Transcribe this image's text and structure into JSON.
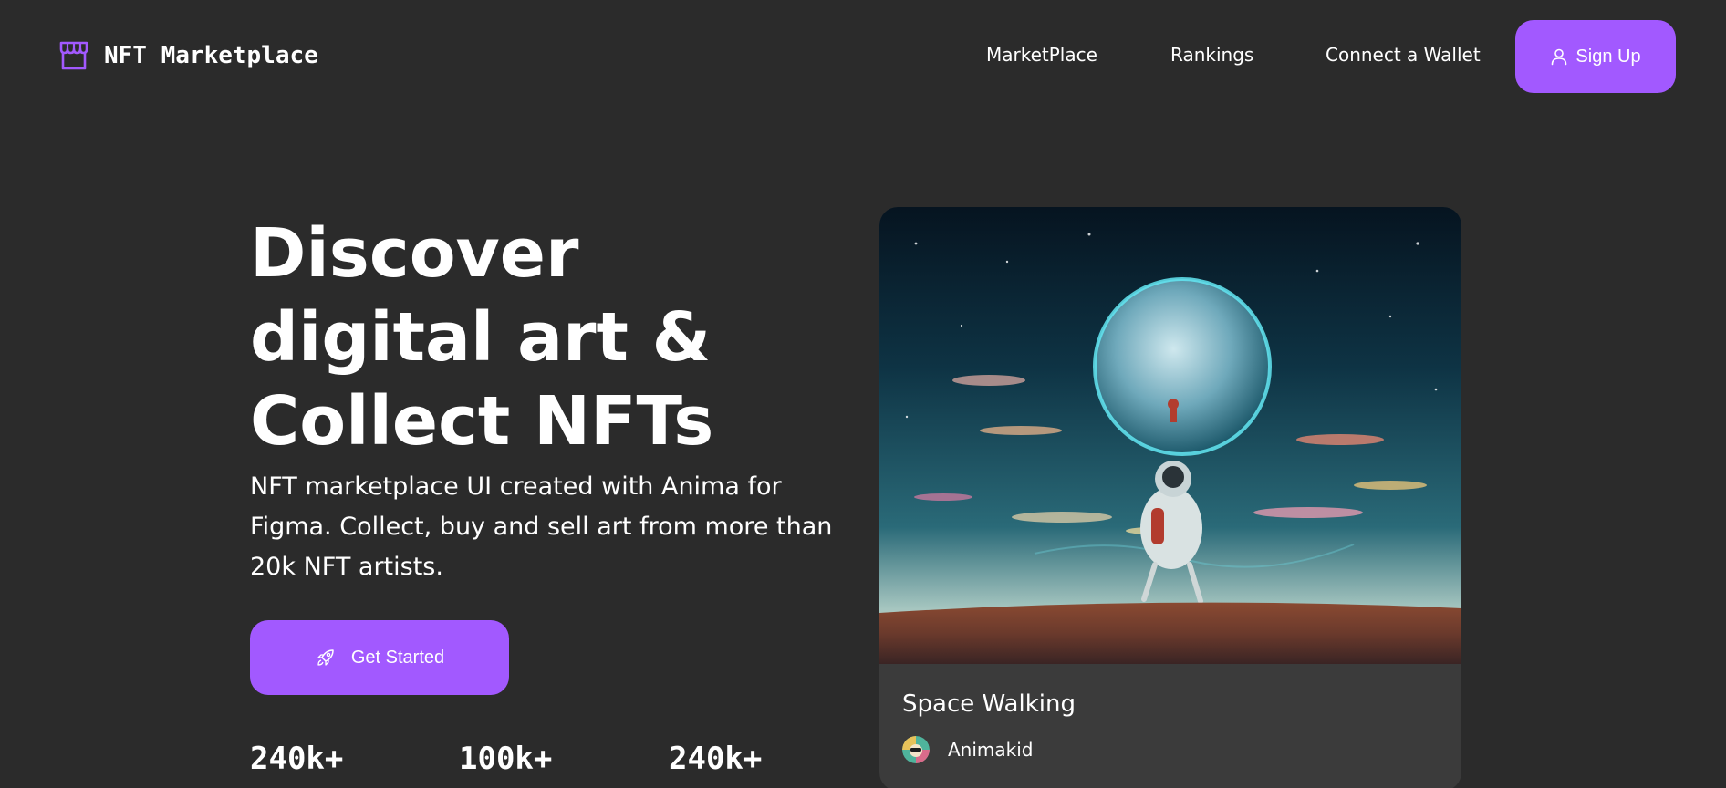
{
  "brand": {
    "name": "NFT Marketplace",
    "accent": "#a259ff",
    "background": "#2b2b2b",
    "card_background": "#3b3b3b",
    "logo_icon": "storefront-icon"
  },
  "nav": {
    "links": [
      "MarketPlace",
      "Rankings",
      "Connect a Wallet"
    ],
    "signup_label": "Sign Up",
    "signup_icon": "user-icon"
  },
  "hero": {
    "title": "Discover\ndigital art &\nCollect NFTs",
    "description": "NFT marketplace UI created with Anima for Figma. Collect, buy and sell art from more than 20k NFT artists.",
    "cta_label": "Get Started",
    "cta_icon": "rocket-launch-icon",
    "stats": [
      "240k+",
      "100k+",
      "240k+"
    ]
  },
  "featured": {
    "title": "Space Walking",
    "artist": "Animakid",
    "artwork_icon": "astronaut-planet-artwork",
    "avatar_icon": "artist-avatar"
  }
}
